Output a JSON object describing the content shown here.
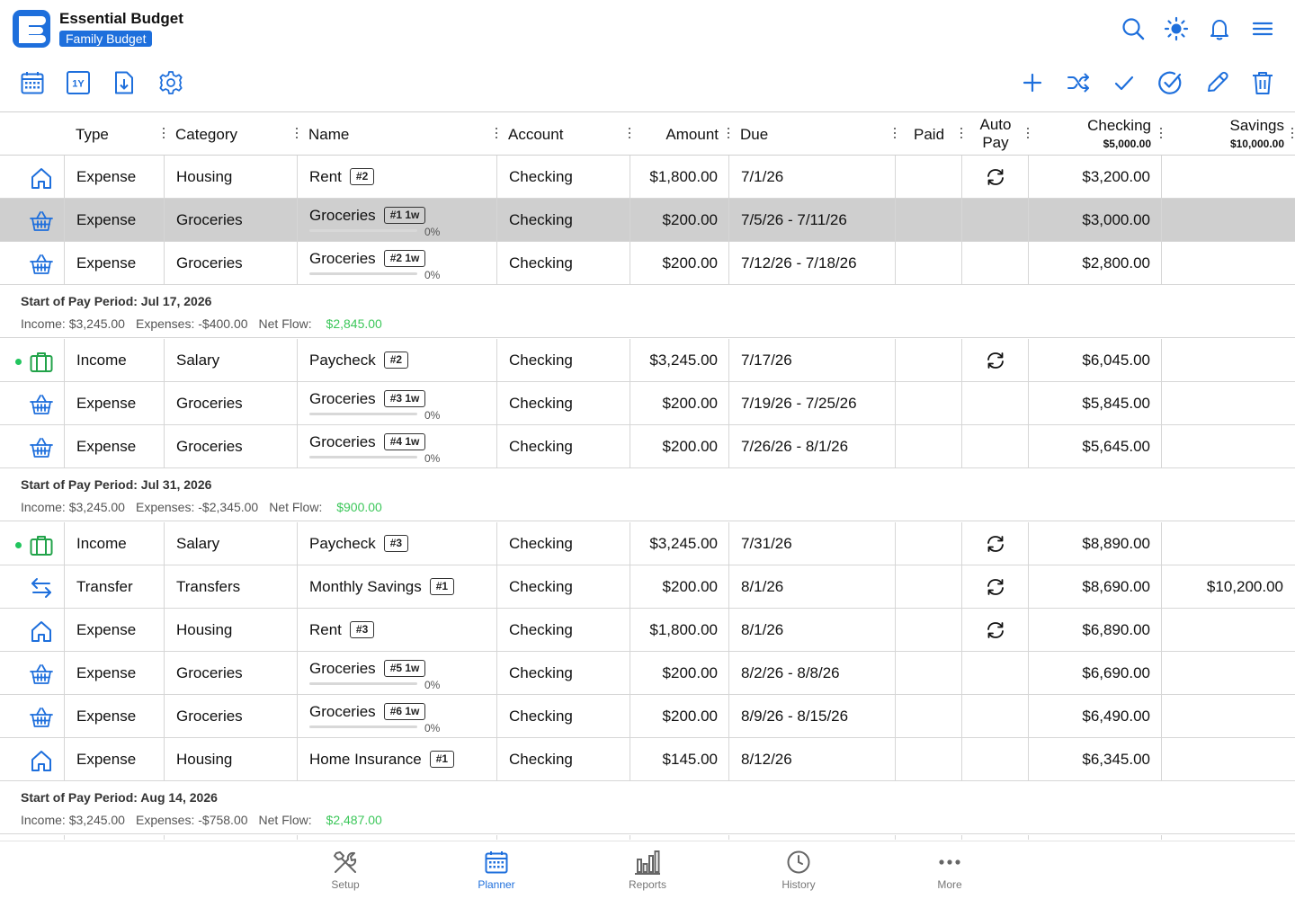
{
  "app": {
    "title": "Essential Budget",
    "budget_name": "Family Budget"
  },
  "columns": {
    "type": "Type",
    "category": "Category",
    "name": "Name",
    "account": "Account",
    "amount": "Amount",
    "due": "Due",
    "paid": "Paid",
    "autopay_line1": "Auto",
    "autopay_line2": "Pay",
    "checking": "Checking",
    "checking_start": "$5,000.00",
    "savings": "Savings",
    "savings_start": "$10,000.00"
  },
  "rows": [
    {
      "icon": "house-icon",
      "type": "Expense",
      "category": "Housing",
      "name": "Rent",
      "tag": "#2",
      "account": "Checking",
      "amount": "$1,800.00",
      "due": "7/1/26",
      "autopay": true,
      "checking": "$3,200.00",
      "savings": ""
    },
    {
      "icon": "basket-icon",
      "type": "Expense",
      "category": "Groceries",
      "name": "Groceries",
      "tag": "#1 1w",
      "progress": "0%",
      "account": "Checking",
      "amount": "$200.00",
      "due": "7/5/26 - 7/11/26",
      "checking": "$3,000.00",
      "savings": "",
      "selected": true
    },
    {
      "icon": "basket-icon",
      "type": "Expense",
      "category": "Groceries",
      "name": "Groceries",
      "tag": "#2 1w",
      "progress": "0%",
      "account": "Checking",
      "amount": "$200.00",
      "due": "7/12/26 - 7/18/26",
      "checking": "$2,800.00",
      "savings": ""
    },
    {
      "icon": "briefcase-icon",
      "dot": true,
      "type": "Income",
      "category": "Salary",
      "name": "Paycheck",
      "tag": "#2",
      "account": "Checking",
      "amount": "$3,245.00",
      "due": "7/17/26",
      "autopay": true,
      "checking": "$6,045.00",
      "savings": ""
    },
    {
      "icon": "basket-icon",
      "type": "Expense",
      "category": "Groceries",
      "name": "Groceries",
      "tag": "#3 1w",
      "progress": "0%",
      "account": "Checking",
      "amount": "$200.00",
      "due": "7/19/26 - 7/25/26",
      "checking": "$5,845.00",
      "savings": ""
    },
    {
      "icon": "basket-icon",
      "type": "Expense",
      "category": "Groceries",
      "name": "Groceries",
      "tag": "#4 1w",
      "progress": "0%",
      "account": "Checking",
      "amount": "$200.00",
      "due": "7/26/26 - 8/1/26",
      "checking": "$5,645.00",
      "savings": ""
    },
    {
      "icon": "briefcase-icon",
      "dot": true,
      "type": "Income",
      "category": "Salary",
      "name": "Paycheck",
      "tag": "#3",
      "account": "Checking",
      "amount": "$3,245.00",
      "due": "7/31/26",
      "autopay": true,
      "checking": "$8,890.00",
      "savings": ""
    },
    {
      "icon": "transfer-icon",
      "type": "Transfer",
      "category": "Transfers",
      "name": "Monthly Savings",
      "tag": "#1",
      "account": "Checking",
      "amount": "$200.00",
      "due": "8/1/26",
      "autopay": true,
      "checking": "$8,690.00",
      "savings": "$10,200.00"
    },
    {
      "icon": "house-icon",
      "type": "Expense",
      "category": "Housing",
      "name": "Rent",
      "tag": "#3",
      "account": "Checking",
      "amount": "$1,800.00",
      "due": "8/1/26",
      "autopay": true,
      "checking": "$6,890.00",
      "savings": ""
    },
    {
      "icon": "basket-icon",
      "type": "Expense",
      "category": "Groceries",
      "name": "Groceries",
      "tag": "#5 1w",
      "progress": "0%",
      "account": "Checking",
      "amount": "$200.00",
      "due": "8/2/26 - 8/8/26",
      "checking": "$6,690.00",
      "savings": ""
    },
    {
      "icon": "basket-icon",
      "type": "Expense",
      "category": "Groceries",
      "name": "Groceries",
      "tag": "#6 1w",
      "progress": "0%",
      "account": "Checking",
      "amount": "$200.00",
      "due": "8/9/26 - 8/15/26",
      "checking": "$6,490.00",
      "savings": ""
    },
    {
      "icon": "house-icon",
      "type": "Expense",
      "category": "Housing",
      "name": "Home Insurance",
      "tag": "#1",
      "account": "Checking",
      "amount": "$145.00",
      "due": "8/12/26",
      "checking": "$6,345.00",
      "savings": ""
    }
  ],
  "periods": [
    {
      "title": "Start of Pay Period: Jul 17, 2026",
      "income": "Income: $3,245.00",
      "expenses": "Expenses: -$400.00",
      "net_label": "Net Flow: ",
      "net": "$2,845.00"
    },
    {
      "title": "Start of Pay Period: Jul 31, 2026",
      "income": "Income: $3,245.00",
      "expenses": "Expenses: -$2,345.00",
      "net_label": "Net Flow: ",
      "net": "$900.00"
    },
    {
      "title": "Start of Pay Period: Aug 14, 2026",
      "income": "Income: $3,245.00",
      "expenses": "Expenses: -$758.00",
      "net_label": "Net Flow: ",
      "net": "$2,487.00"
    }
  ],
  "nav": [
    {
      "label": "Setup",
      "icon": "tools-icon"
    },
    {
      "label": "Planner",
      "icon": "calendar-icon",
      "active": true
    },
    {
      "label": "Reports",
      "icon": "bar-chart-icon"
    },
    {
      "label": "History",
      "icon": "clock-icon"
    },
    {
      "label": "More",
      "icon": "more-icon"
    }
  ],
  "colors": {
    "accent": "#1e6fdc",
    "positive": "#3cc75a",
    "selected_row": "#cfcfcf"
  }
}
